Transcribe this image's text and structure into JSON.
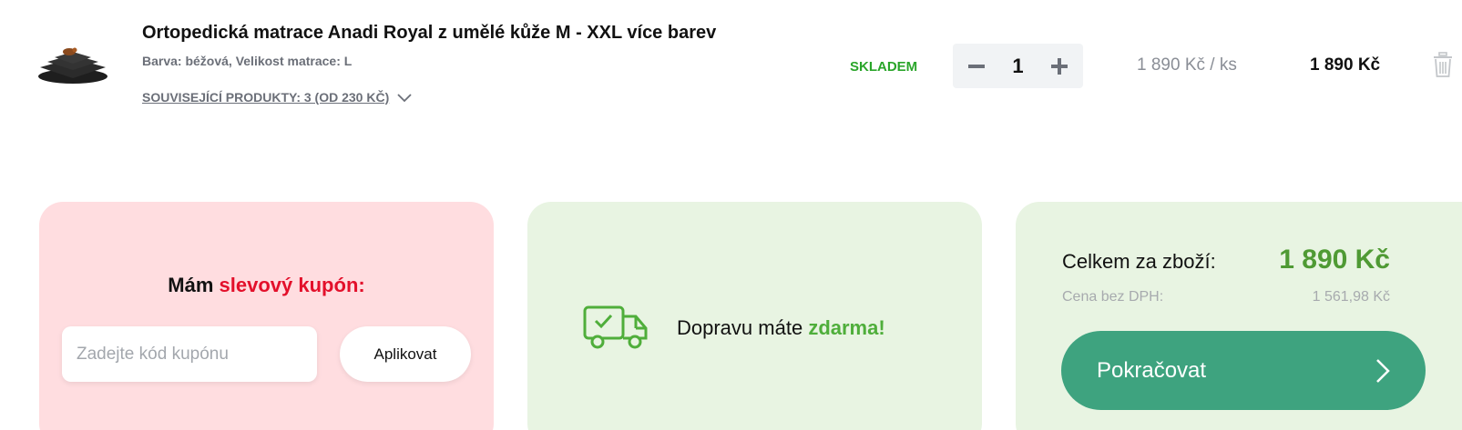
{
  "cart_item": {
    "title": "Ortopedická matrace Anadi Royal z umělé kůže M - XXL více barev",
    "variant": "Barva: béžová, Velikost matrace: L",
    "related_label": "SOUVISEJÍCÍ PRODUKTY: 3 (OD 230 KČ)",
    "stock_status": "SKLADEM",
    "quantity": "1",
    "unit_price": "1 890 Kč",
    "unit_suffix": "/ ks",
    "line_total": "1 890 Kč",
    "icons": [
      "product-thumbnail",
      "chevron-down-icon",
      "minus-icon",
      "plus-icon",
      "trash-icon"
    ]
  },
  "coupon": {
    "heading_prefix": "Mám",
    "heading_accent": "slevový kupón:",
    "input_placeholder": "Zadejte kód kupónu",
    "input_value": "",
    "apply_label": "Aplikovat"
  },
  "shipping": {
    "text_prefix": "Dopravu máte",
    "text_accent": "zdarma!",
    "icon": "delivery-truck-icon"
  },
  "summary": {
    "total_label": "Celkem za zboží:",
    "total_value": "1 890 Kč",
    "vat_label": "Cena bez DPH:",
    "vat_value": "1 561,98 Kč",
    "continue_label": "Pokračovat",
    "continue_icon": "chevron-right-icon"
  },
  "colors": {
    "coupon_bg": "#ffdde0",
    "accent_red": "#e3102b",
    "panel_green_bg": "#e8f4e2",
    "accent_green": "#4fae3b",
    "total_green": "#4f9a34",
    "stock_green": "#2aa52a",
    "button_green": "#3ea37f"
  }
}
